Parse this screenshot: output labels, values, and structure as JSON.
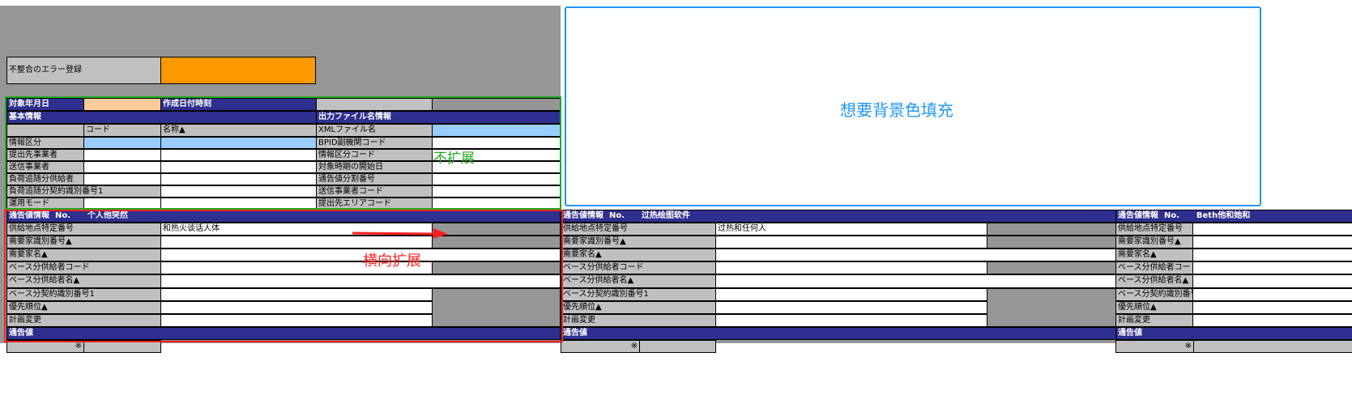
{
  "error_section": {
    "label": "不整合のエラー登録"
  },
  "basic": {
    "target_date_label": "対象年月日",
    "created_label": "作成日付時刻",
    "basic_info_label": "基本情報",
    "output_file_label": "出力ファイル名情報",
    "code_header": "コード",
    "name_header": "名称▲",
    "left_rows": [
      "情報区分",
      "提出先事業者",
      "送信事業者",
      "負荷追随分供給者",
      "負荷追随分契約識別番号1",
      "運用モード"
    ],
    "right_rows": [
      "XMLファイル名",
      "BPID副機関コード",
      "情報区分コード",
      "対象時期の開始日",
      "通告値分割番号",
      "送信事業者コード",
      "提出先エリアコード"
    ]
  },
  "notify_common": {
    "no_label": "No.",
    "rows": [
      "供給地点特定番号",
      "需要家識別番号▲",
      "需要家名▲",
      "ベース分供給者コード",
      "ベース分供給者名▲",
      "ベース分契約識別番号1",
      "優先順位▲",
      "計画変更"
    ],
    "footer": "通告値",
    "mark": "※"
  },
  "blocks": [
    {
      "title": "通告値情報",
      "name": "个人他突然",
      "supply_value": "和热火谈话人体"
    },
    {
      "title": "通告値情報",
      "name": "过热绘图软件",
      "supply_value": "过热和任何人"
    },
    {
      "title": "通告値情報",
      "name": "Beth他和她和",
      "supply_value": ""
    }
  ],
  "annotations": {
    "no_expand": "不扩展",
    "horizontal_expand": "横向扩展",
    "want_bg_fill": "想要背景色填充"
  },
  "colors": {
    "header_navy": "#2f2f8f",
    "gray": "#969696",
    "light_gray": "#c0c0c0",
    "light_blue": "#99ccff",
    "orange": "#ff9900",
    "green_box": "#22aa22",
    "red_box": "#ff2020",
    "blue_box": "#2196f3"
  }
}
